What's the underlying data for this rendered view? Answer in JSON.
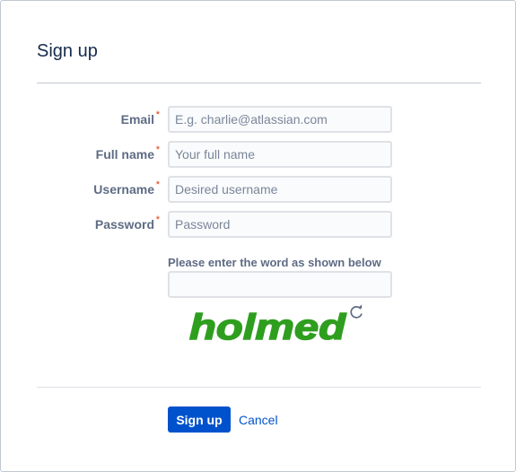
{
  "dialog": {
    "title": "Sign up"
  },
  "form": {
    "fields": [
      {
        "label": "Email",
        "required_mark": "*",
        "placeholder": "E.g. charlie@atlassian.com",
        "value": ""
      },
      {
        "label": "Full name",
        "required_mark": "*",
        "placeholder": "Your full name",
        "value": ""
      },
      {
        "label": "Username",
        "required_mark": "*",
        "placeholder": "Desired username",
        "value": ""
      },
      {
        "label": "Password",
        "required_mark": "*",
        "placeholder": "Password",
        "value": ""
      }
    ],
    "captcha": {
      "label": "Please enter the word as shown below",
      "value": "",
      "image_text": "holmed",
      "image_color": "#2e9e1f",
      "refresh_icon": "refresh-icon"
    }
  },
  "actions": {
    "submit_label": "Sign up",
    "cancel_label": "Cancel"
  },
  "colors": {
    "primary": "#0052cc",
    "required": "#de350b",
    "label": "#5e6c84"
  }
}
